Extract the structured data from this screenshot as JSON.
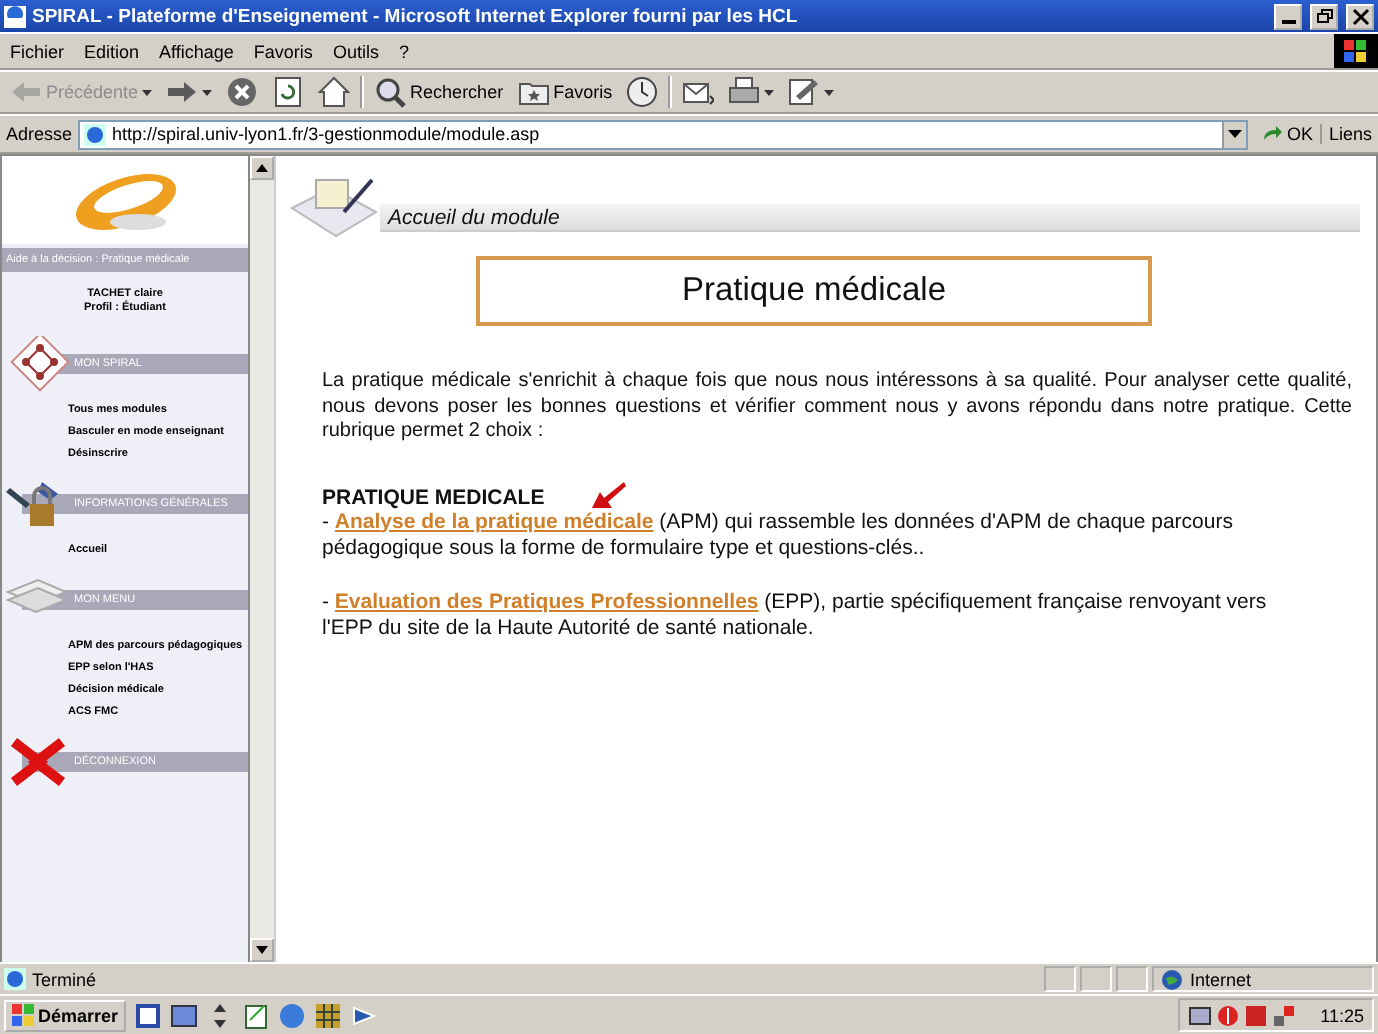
{
  "window": {
    "title": "SPIRAL - Plateforme d'Enseignement - Microsoft Internet Explorer fourni par les HCL"
  },
  "menu": [
    "Fichier",
    "Edition",
    "Affichage",
    "Favoris",
    "Outils",
    "?"
  ],
  "toolbar": [
    {
      "kind": "back",
      "label": "Précédente",
      "disabled": true
    },
    {
      "kind": "forward",
      "disabled": false
    },
    {
      "kind": "stop",
      "disabled": false
    },
    {
      "kind": "refresh",
      "disabled": false
    },
    {
      "kind": "home",
      "disabled": false
    },
    {
      "kind": "search",
      "label": "Rechercher",
      "disabled": false
    },
    {
      "kind": "favorites",
      "label": "Favoris",
      "disabled": false
    },
    {
      "kind": "history",
      "disabled": false
    },
    {
      "kind": "mail",
      "disabled": false
    },
    {
      "kind": "print",
      "disabled": false
    },
    {
      "kind": "edit",
      "disabled": false
    }
  ],
  "address": {
    "label": "Adresse",
    "value": "http://spiral.univ-lyon1.fr/3-gestionmodule/module.asp",
    "go": "OK",
    "links": "Liens"
  },
  "sidebar": {
    "heading": "Aide à la décision : Pratique médicale",
    "user": "TACHET claire",
    "profile": "Profil : Étudiant",
    "sections": [
      {
        "kind": "spiral",
        "title": "MON SPIRAL",
        "items": [
          "Tous mes modules",
          "Basculer en mode enseignant",
          "Désinscrire"
        ]
      },
      {
        "kind": "info",
        "title": "INFORMATIONS GÉNÉRALES",
        "items": [
          "Accueil"
        ]
      },
      {
        "kind": "menu",
        "title": "MON MENU",
        "items": [
          "APM des parcours pédagogiques",
          "EPP selon l'HAS",
          "Décision médicale",
          "ACS FMC"
        ]
      },
      {
        "kind": "logout",
        "title": "DÉCONNEXION"
      }
    ]
  },
  "page": {
    "section": "Accueil du module",
    "title": "Pratique médicale",
    "intro": "La pratique médicale s'enrichit à chaque fois que nous nous intéressons à sa qualité. Pour analyser cette qualité, nous devons poser les bonnes questions et vérifier comment nous y avons répondu dans notre pratique. Cette rubrique permet 2 choix :",
    "heading": "PRATIQUE MEDICALE",
    "entries": [
      {
        "bullet": "- ",
        "link": "Analyse de la pratique médicale",
        "text": " (APM) qui rassemble les données d'APM de chaque parcours pédagogique sous la forme de formulaire type et questions-clés..",
        "pointer": true
      },
      {
        "bullet": "- ",
        "link": "Evaluation des Pratiques Professionnelles",
        "text": " (EPP), partie spécifiquement française renvoyant vers l'EPP du site de la Haute Autorité de santé nationale.",
        "pointer": false
      }
    ]
  },
  "status_bar": {
    "text": "Terminé",
    "zone": "Internet"
  },
  "taskbar": {
    "start": "Démarrer",
    "clock": "11:25"
  }
}
